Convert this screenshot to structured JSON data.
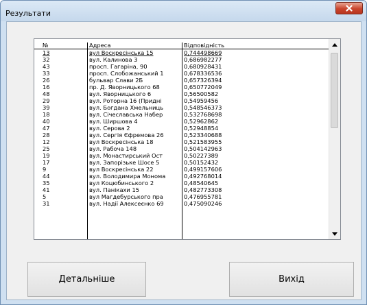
{
  "window": {
    "title": "Результати",
    "close_label": "x"
  },
  "list": {
    "columns": [
      "№",
      "Адреса",
      "Відповідність"
    ],
    "rows": [
      [
        "13",
        "вул Воскресінська  15",
        "0,744498669"
      ],
      [
        "32",
        "вул. Калинова 3",
        "0,686982277"
      ],
      [
        "43",
        "просп. Гагаріна, 90",
        "0,680928431"
      ],
      [
        "33",
        "просп. Слобожанський 1",
        "0,678336536"
      ],
      [
        "26",
        "бульвар Слави 2Б",
        "0,657326394"
      ],
      [
        "16",
        "пр. Д. Яворницького 68",
        "0,650772049"
      ],
      [
        "48",
        "вул. Яворницького 6",
        "0,56500582"
      ],
      [
        "29",
        "вул. Роторна 16 (Придні",
        "0,54959456"
      ],
      [
        "39",
        " вул. Богдана Хмельниць",
        "0,548546373"
      ],
      [
        "18",
        "вул. Січеславська Набер",
        "0,532768698"
      ],
      [
        "40",
        "вул. Ширшова 4",
        "0,52962862"
      ],
      [
        "47",
        "вул. Серова 2",
        "0,52948854"
      ],
      [
        "28",
        "вул. Сергія Єфремова 26",
        "0,523340688"
      ],
      [
        "12",
        "вул Воскресінська  18",
        "0,521583955"
      ],
      [
        "25",
        "вул. Рабоча 148",
        "0,504142963"
      ],
      [
        "19",
        "вул. Монастирський Ост",
        "0,50227389"
      ],
      [
        "17",
        "вул. Запорізьке Шосе 5",
        "0,50152432"
      ],
      [
        "9",
        "вул Воскресінська 22",
        "0,499157606"
      ],
      [
        "44",
        "вул. Володимира Монома",
        "0,492768014"
      ],
      [
        "35",
        "вул Коцюбинського 2",
        "0,48540645"
      ],
      [
        "41",
        "вул. Панікахи 15",
        "0,482773308"
      ],
      [
        "5",
        "вул Магдебурського пра",
        "0,476955781"
      ],
      [
        "31",
        "вул. Надії Алексеєнко 69",
        "0,475090246"
      ]
    ]
  },
  "buttons": {
    "details": "Детальніше",
    "exit": "Вихід"
  }
}
